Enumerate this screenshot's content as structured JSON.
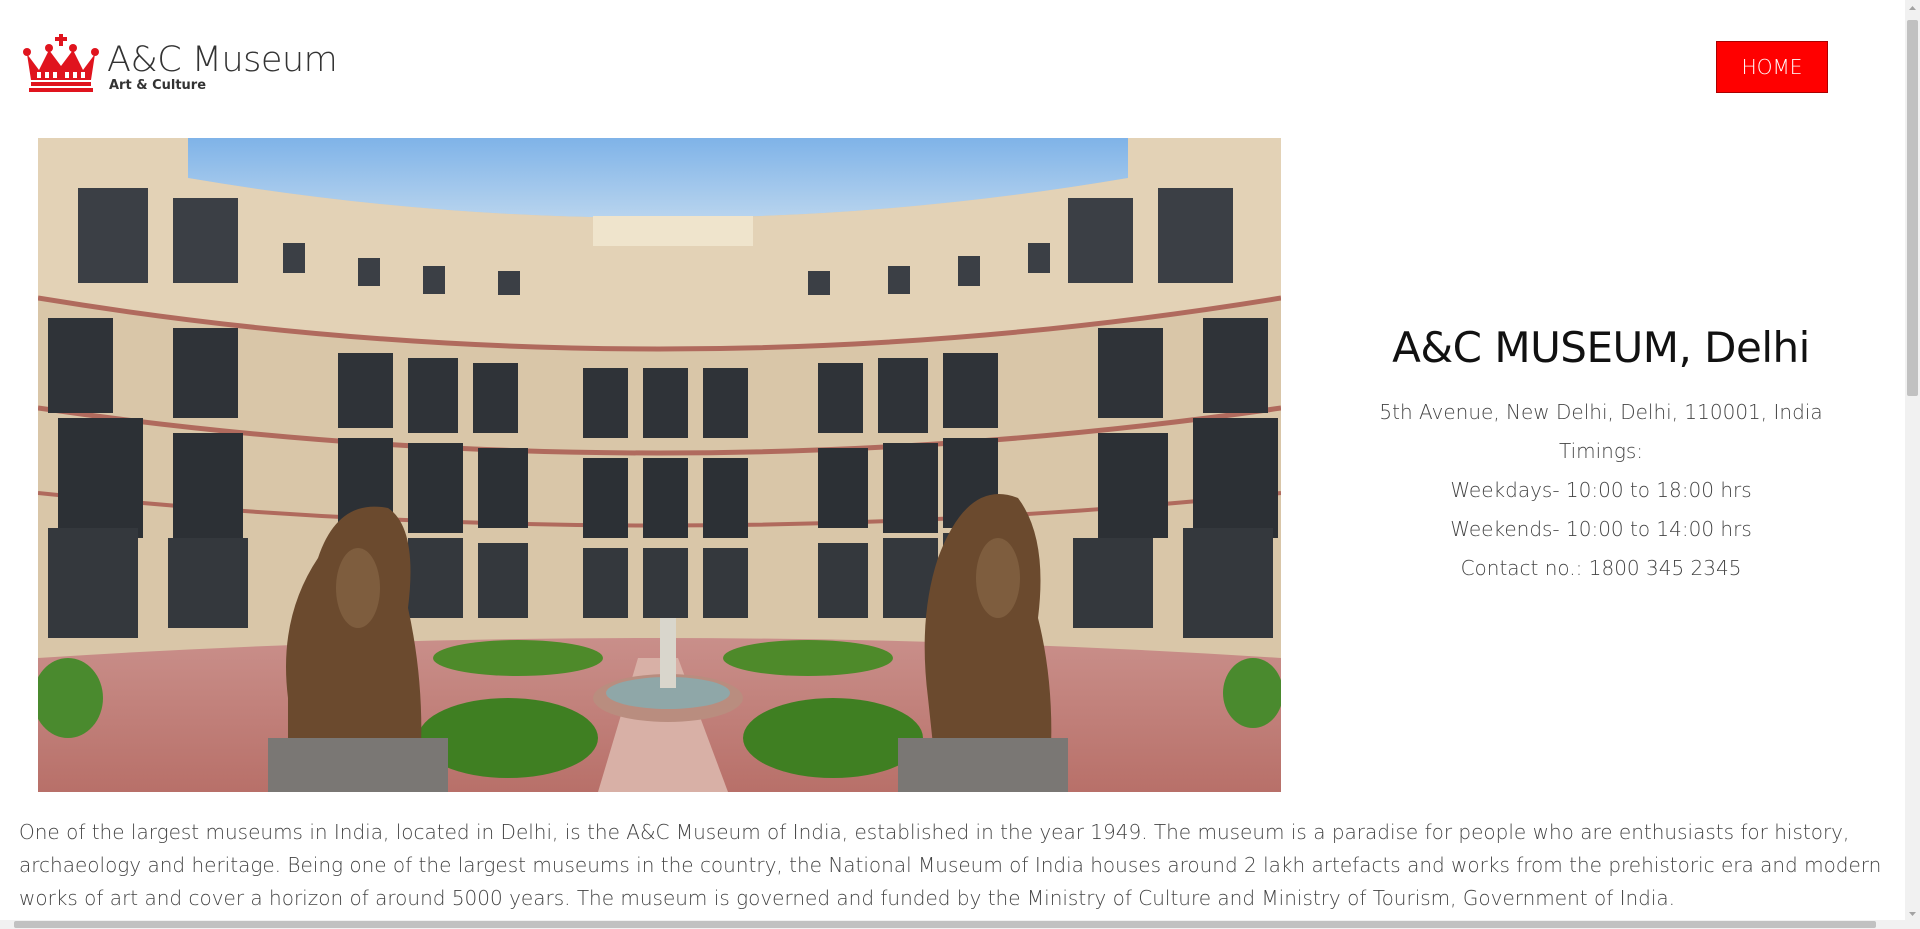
{
  "header": {
    "logo_title": "A&C Museum",
    "logo_subtitle": "Art & Culture",
    "home_label": "HOME"
  },
  "info": {
    "title": "A&C MUSEUM, Delhi",
    "address": "5th Avenue, New Delhi, Delhi, 110001, India",
    "timings_label": "Timings:",
    "weekdays": "Weekdays- 10:00 to 18:00 hrs",
    "weekends": "Weekends- 10:00 to 14:00 hrs",
    "contact": "Contact no.: 1800 345 2345"
  },
  "description": "One of the largest museums in India, located in Delhi, is the A&C Museum of India, established in the year 1949. The museum is a paradise for people who are enthusiasts for history, archaeology and heritage. Being one of the largest museums in the country, the National Museum of India houses around 2 lakh artefacts and works from the prehistoric era and modern works of art and cover a horizon of around 5000 years. The museum is governed and funded by the Ministry of Culture and Ministry of Tourism, Government of India.",
  "colors": {
    "accent": "#ff0000",
    "text": "#444444"
  },
  "icons": {
    "logo": "crown-icon"
  }
}
